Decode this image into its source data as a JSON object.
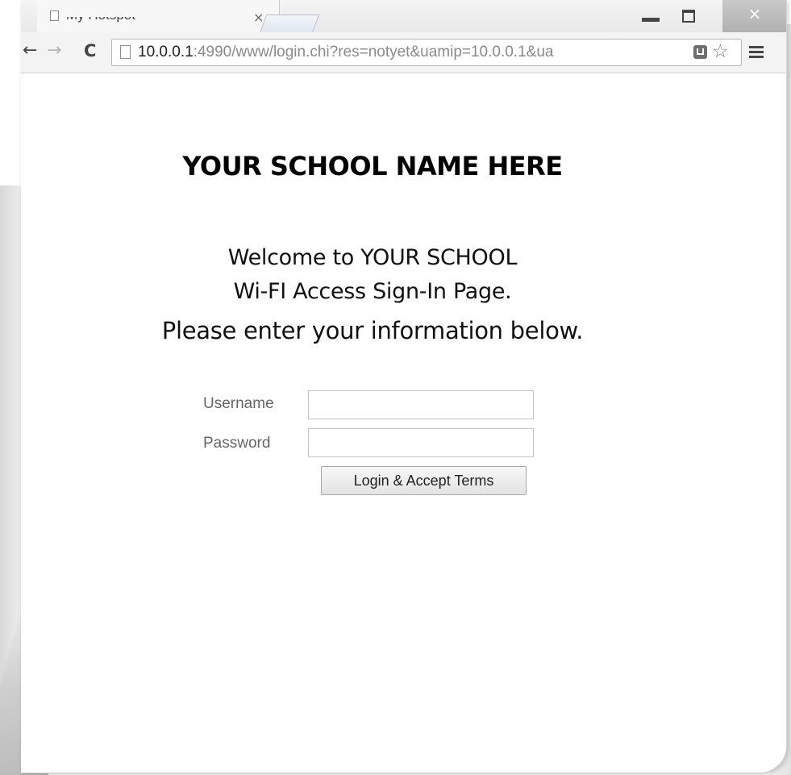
{
  "browser": {
    "tab": {
      "title": "My Hotspot",
      "close_glyph": "×"
    },
    "window_controls": {
      "close_glyph": "×"
    },
    "toolbar": {
      "back_glyph": "←",
      "forward_glyph": "→",
      "reload_glyph": "C",
      "url_host": "10.0.0.1",
      "url_rest": ":4990/www/login.chi?res=notyet&uamip=10.0.0.1&ua",
      "star_glyph": "☆"
    }
  },
  "page": {
    "school_name": "YOUR SCHOOL NAME HERE",
    "welcome_line1": "Welcome to YOUR SCHOOL",
    "welcome_line2": "Wi-FI Access Sign-In Page.",
    "welcome_line3": "Please enter your information below.",
    "form": {
      "username_label": "Username",
      "username_value": "",
      "password_label": "Password",
      "password_value": "",
      "login_button": "Login & Accept Terms"
    }
  }
}
